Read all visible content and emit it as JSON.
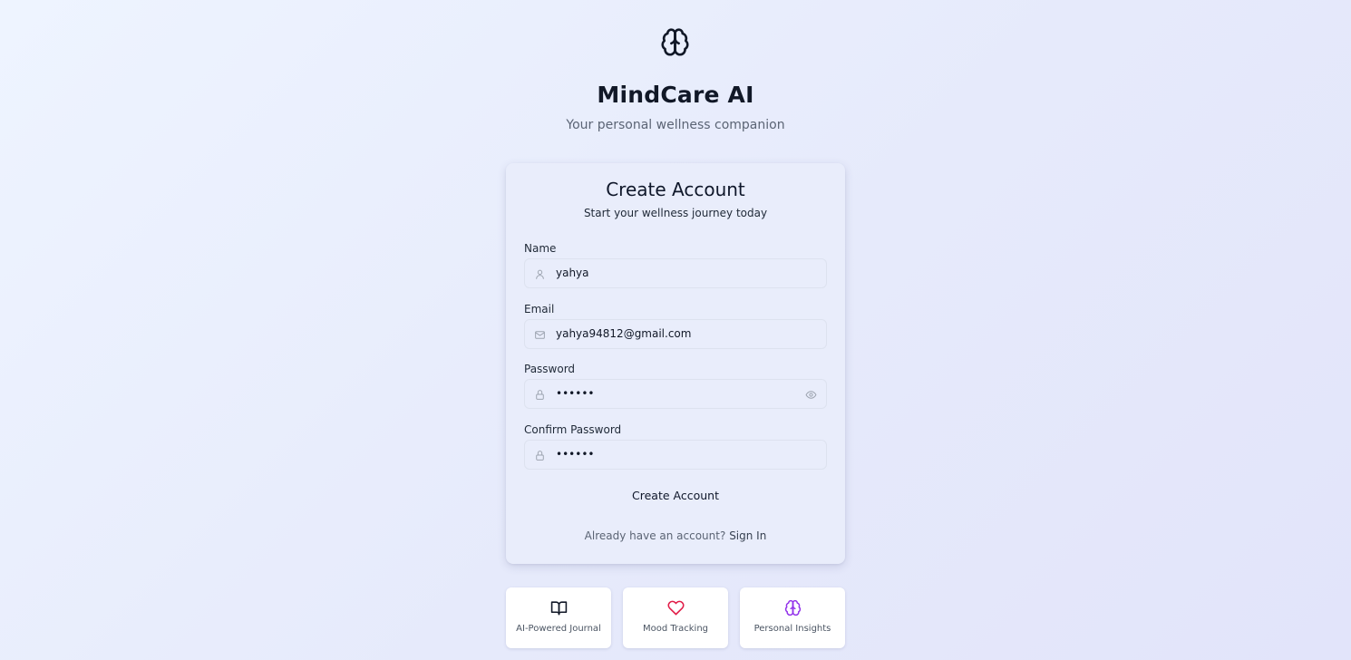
{
  "header": {
    "logo_icon": "brain-icon",
    "title": "MindCare AI",
    "subtitle": "Your personal wellness companion"
  },
  "form": {
    "title": "Create Account",
    "subtitle": "Start your wellness journey today",
    "fields": {
      "name": {
        "label": "Name",
        "value": "yahya",
        "icon": "user-icon"
      },
      "email": {
        "label": "Email",
        "value": "yahya94812@gmail.com",
        "icon": "mail-icon"
      },
      "password": {
        "label": "Password",
        "value": "••••••",
        "icon": "lock-icon",
        "toggle_icon": "eye-icon"
      },
      "confirm_password": {
        "label": "Confirm Password",
        "value": "••••••",
        "icon": "lock-icon"
      }
    },
    "submit_label": "Create Account",
    "signin_prompt": "Already have an account?",
    "signin_link": "Sign In"
  },
  "features": [
    {
      "label": "AI-Powered Journal",
      "icon": "book-open-icon",
      "color": "#111827"
    },
    {
      "label": "Mood Tracking",
      "icon": "heart-icon",
      "color": "#e11d48"
    },
    {
      "label": "Personal Insights",
      "icon": "brain-icon",
      "color": "#9333ea"
    }
  ]
}
